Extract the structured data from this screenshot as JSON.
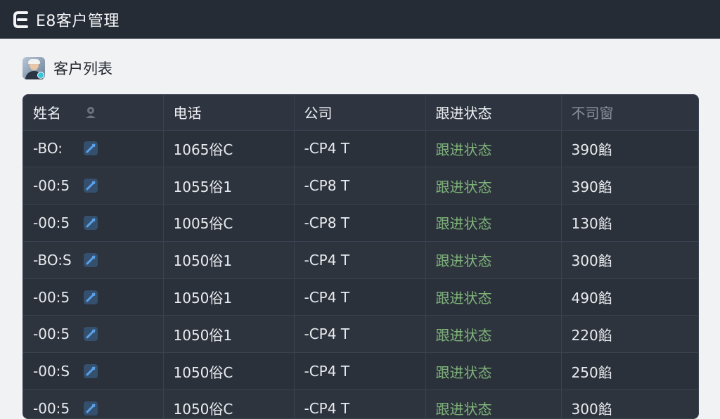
{
  "app": {
    "title": "E8客户管理"
  },
  "section": {
    "title": "客户列表"
  },
  "table": {
    "headers": [
      "姓名",
      "电话",
      "公司",
      "跟进状态",
      "不司窗"
    ],
    "rows": [
      {
        "name": "-BO:",
        "phone": "1065俗C",
        "company": "-CP4 T",
        "status": "跟进状态",
        "value": "390餡"
      },
      {
        "name": "-00:5",
        "phone": "1055俗1",
        "company": "-CP8 T",
        "status": "跟进状态",
        "value": "390餡"
      },
      {
        "name": "-00:5",
        "phone": "1005俗C",
        "company": "-CP8 T",
        "status": "跟进状态",
        "value": "130餡"
      },
      {
        "name": "-BO:S",
        "phone": "1050俗1",
        "company": "-CP4 T",
        "status": "跟进状态",
        "value": "300餡"
      },
      {
        "name": "-00:5",
        "phone": "1050俗1",
        "company": "-CP4 T",
        "status": "跟进状态",
        "value": "490餡"
      },
      {
        "name": "-00:5",
        "phone": "1050俗1",
        "company": "-CP4 T",
        "status": "跟进状态",
        "value": "220餡"
      },
      {
        "name": "-00:S",
        "phone": "1050俗C",
        "company": "-CP4 T",
        "status": "跟进状态",
        "value": "250餡"
      },
      {
        "name": "-00:5",
        "phone": "1050俗C",
        "company": "-CP4 T",
        "status": "跟进状态",
        "value": "300餡"
      }
    ]
  },
  "icons": {
    "logo": "logo-e-icon",
    "sort": "sort-icon",
    "edit": "edit-icon"
  },
  "colors": {
    "topbar": "#262c36",
    "table_bg": "#2b313b",
    "status_green": "#7fb47a",
    "edit_blue": "#4a8fd6"
  }
}
